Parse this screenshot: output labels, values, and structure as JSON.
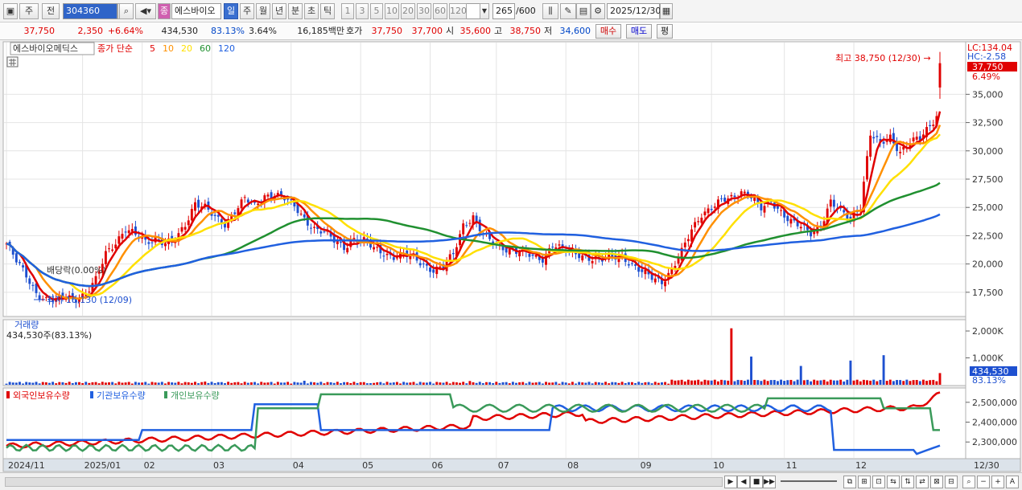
{
  "toolbar": {
    "market": "주",
    "prev_label": "전",
    "code": "304360",
    "type_tag": "종",
    "name": "에스바이오",
    "periods": [
      "일",
      "주",
      "월",
      "년",
      "분",
      "초",
      "틱"
    ],
    "period_selected": 0,
    "minutes": [
      "1",
      "3",
      "5",
      "10",
      "20",
      "30",
      "60",
      "120"
    ],
    "count": "265",
    "count_total": "/600",
    "date": "2025/12/30"
  },
  "info": {
    "price": "37,750",
    "change": "2,350",
    "change_pct": "+6.64%",
    "volume": "434,530",
    "vol_ratio": "83.13%",
    "turnover": "3.64%",
    "amount": "16,185백만",
    "ask_label": "호가",
    "ask1": "37,750",
    "ask2": "37,700",
    "open_label": "시",
    "open": "35,600",
    "high_label": "고",
    "high": "38,750",
    "low_label": "저",
    "low": "34,600",
    "buy": "매수",
    "sell": "매도",
    "avg": "평"
  },
  "legend": {
    "stock": "에스바이오메딕스",
    "ma_label": "종가 단순",
    "ma_periods": [
      "5",
      "10",
      "20",
      "60",
      "120"
    ],
    "volume_title": "거래량",
    "volume_value": "434,530주(83.13%)",
    "holdings": [
      "외국인보유수량",
      "기관보유수량",
      "개인보유수량"
    ]
  },
  "annotations": {
    "high": "최고 38,750 (12/30) →",
    "low": "최저 16,130 (12/09)",
    "dividend": "배당락(0.00%)",
    "lc": "LC:134.04",
    "hc": "HC:-2.58",
    "price_tag": "37,750",
    "pct_tag": "6.49%",
    "vol_tag": "434,530",
    "vol_pct_tag": "83.13%"
  },
  "axes": {
    "price_ticks": [
      "35,000",
      "32,500",
      "30,000",
      "27,500",
      "25,000",
      "22,500",
      "20,000",
      "17,500"
    ],
    "volume_ticks": [
      "2,000K",
      "1,000K"
    ],
    "holding_ticks": [
      "2,500,000",
      "2,400,000",
      "2,300,000"
    ],
    "months": [
      "2024/11",
      "2025/01",
      "02",
      "03",
      "04",
      "05",
      "06",
      "07",
      "08",
      "09",
      "10",
      "11",
      "12"
    ],
    "end_date": "12/30"
  },
  "colors": {
    "up": "#e00000",
    "down": "#1e50d0",
    "ma5": "#e00000",
    "ma10": "#ff9000",
    "ma20": "#ffe000",
    "ma60": "#209030",
    "ma120": "#2060e0",
    "foreign": "#e00000",
    "inst": "#2060e0",
    "indiv": "#3a9a5a"
  },
  "chart_data": {
    "type": "line",
    "ylim": [
      15500,
      39500
    ],
    "months": [
      "2024/11",
      "2025/01",
      "02",
      "03",
      "04",
      "05",
      "06",
      "07",
      "08",
      "09",
      "10",
      "11",
      "12"
    ],
    "close_trend": [
      [
        0,
        21800
      ],
      [
        3,
        20200
      ],
      [
        6,
        19000
      ],
      [
        9,
        17500
      ],
      [
        12,
        16800
      ],
      [
        15,
        16700
      ],
      [
        18,
        17200
      ],
      [
        21,
        17000
      ],
      [
        24,
        17300
      ],
      [
        27,
        18500
      ],
      [
        30,
        21000
      ],
      [
        33,
        22000
      ],
      [
        36,
        23000
      ],
      [
        39,
        22500
      ],
      [
        42,
        22000
      ],
      [
        45,
        22300
      ],
      [
        48,
        21800
      ],
      [
        51,
        22000
      ],
      [
        54,
        23500
      ],
      [
        57,
        25500
      ],
      [
        60,
        25000
      ],
      [
        63,
        24000
      ],
      [
        66,
        23500
      ],
      [
        69,
        24800
      ],
      [
        72,
        25800
      ],
      [
        75,
        25000
      ],
      [
        78,
        26000
      ],
      [
        81,
        26300
      ],
      [
        84,
        25800
      ],
      [
        87,
        25000
      ],
      [
        90,
        24000
      ],
      [
        93,
        23200
      ],
      [
        96,
        22800
      ],
      [
        99,
        22000
      ],
      [
        102,
        21500
      ],
      [
        105,
        22300
      ],
      [
        108,
        22000
      ],
      [
        111,
        21300
      ],
      [
        114,
        21000
      ],
      [
        117,
        20700
      ],
      [
        120,
        20800
      ],
      [
        123,
        20500
      ],
      [
        126,
        20000
      ],
      [
        129,
        19500
      ],
      [
        132,
        19700
      ],
      [
        135,
        20800
      ],
      [
        138,
        23500
      ],
      [
        141,
        24200
      ],
      [
        144,
        22500
      ],
      [
        147,
        21800
      ],
      [
        150,
        21500
      ],
      [
        153,
        21200
      ],
      [
        156,
        21000
      ],
      [
        159,
        20600
      ],
      [
        162,
        20500
      ],
      [
        165,
        21800
      ],
      [
        168,
        21200
      ],
      [
        171,
        21000
      ],
      [
        174,
        20800
      ],
      [
        177,
        20500
      ],
      [
        180,
        20300
      ],
      [
        183,
        20600
      ],
      [
        186,
        20800
      ],
      [
        189,
        19900
      ],
      [
        192,
        19200
      ],
      [
        195,
        18800
      ],
      [
        198,
        18500
      ],
      [
        201,
        19500
      ],
      [
        204,
        21000
      ],
      [
        207,
        23000
      ],
      [
        210,
        24500
      ],
      [
        213,
        25000
      ],
      [
        216,
        25500
      ],
      [
        219,
        25800
      ],
      [
        222,
        26500
      ],
      [
        225,
        26000
      ],
      [
        228,
        24800
      ],
      [
        231,
        25500
      ],
      [
        234,
        24700
      ],
      [
        237,
        23800
      ],
      [
        240,
        23200
      ],
      [
        243,
        22700
      ],
      [
        246,
        23500
      ],
      [
        249,
        25500
      ],
      [
        252,
        24500
      ],
      [
        255,
        24000
      ],
      [
        258,
        25200
      ],
      [
        261,
        31500
      ],
      [
        264,
        30500
      ],
      [
        267,
        31200
      ],
      [
        270,
        30000
      ],
      [
        273,
        30800
      ],
      [
        276,
        31000
      ],
      [
        279,
        32200
      ],
      [
        281,
        33200
      ],
      [
        282,
        37750
      ]
    ],
    "volume_k": [
      [
        0,
        40
      ],
      [
        30,
        80
      ],
      [
        60,
        120
      ],
      [
        90,
        150
      ],
      [
        110,
        60
      ],
      [
        140,
        140
      ],
      [
        170,
        50
      ],
      [
        200,
        40
      ],
      [
        219,
        2100
      ],
      [
        225,
        1050
      ],
      [
        240,
        700
      ],
      [
        255,
        900
      ],
      [
        265,
        1100
      ],
      [
        282,
        435
      ]
    ],
    "volume_max_k": 2300,
    "holdings_ylim": [
      2220000,
      2560000
    ]
  }
}
